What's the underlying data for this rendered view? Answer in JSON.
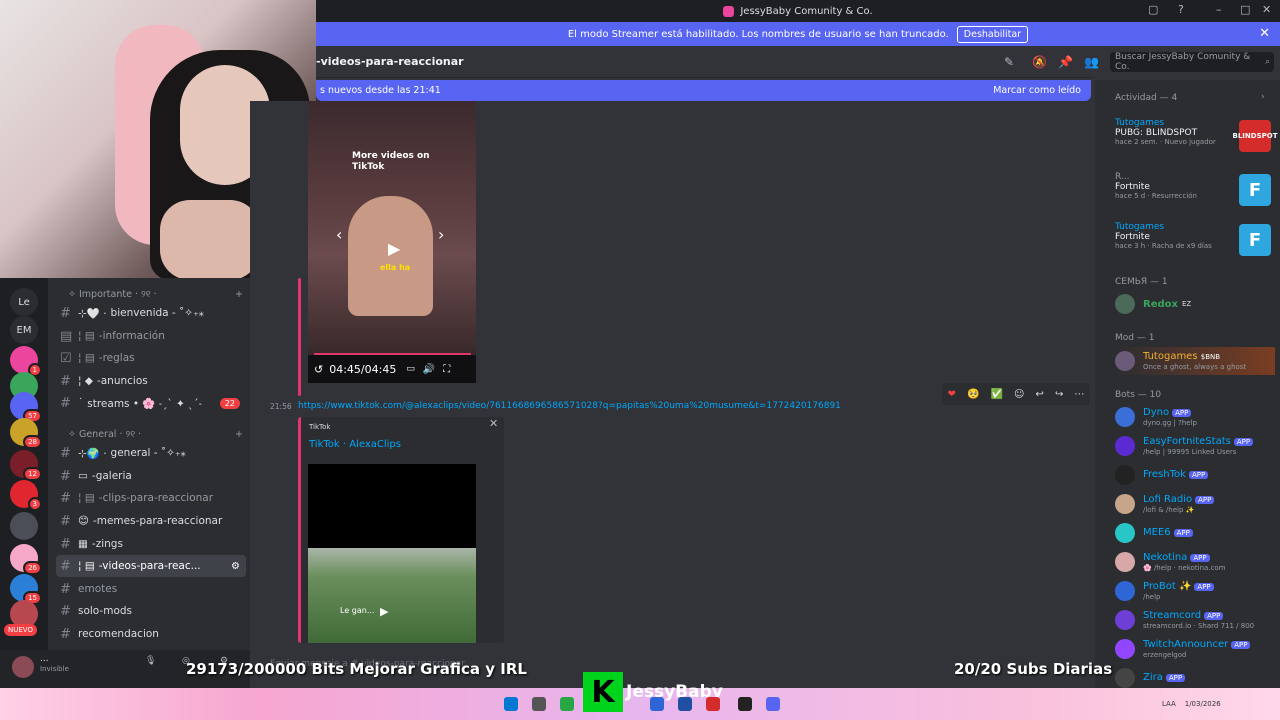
{
  "window": {
    "title": "JessyBaby Comunity & Co.",
    "controls": [
      "▢",
      "?",
      "–",
      "□",
      "✕"
    ]
  },
  "streamer_banner": {
    "text": "El modo Streamer está habilitado. Los nombres de usuario se han truncado.",
    "button": "Deshabilitar",
    "close": "✕"
  },
  "servers": [
    {
      "label": "Le"
    },
    {
      "label": "EM"
    },
    {
      "label": "",
      "badge": "1"
    },
    {
      "label": "",
      "badge": ""
    },
    {
      "label": "",
      "badge": "57"
    },
    {
      "label": "",
      "badge": "28"
    },
    {
      "label": "",
      "badge": "12"
    },
    {
      "label": "",
      "badge": "3"
    },
    {
      "label": "",
      "badge": ""
    },
    {
      "label": "",
      "badge": "26"
    },
    {
      "label": "",
      "badge": "15"
    },
    {
      "label": "",
      "badge": ""
    }
  ],
  "nuevo": "NUEVO",
  "categories": {
    "importante": "✧ Importante · ୨୧ ·",
    "general": "✧ General · ୨୧ ·"
  },
  "channels": [
    {
      "name": "bienvenida - ˚✧₊⁎",
      "prefix": "⊹🤍 ·"
    },
    {
      "name": "-información",
      "prefix": "¦ ▤"
    },
    {
      "name": "-reglas",
      "prefix": "¦ ▤"
    },
    {
      "name": "-anuncios",
      "prefix": "¦ ◆"
    },
    {
      "name": "streams • 🌸 ˗ˏˋ ✦ ˎˊ˗",
      "prefix": "˙",
      "badge": "22"
    },
    {
      "name": "general - ˚✧₊⁎",
      "prefix": "⊹🌍 ·"
    },
    {
      "name": "-galeria",
      "prefix": "▭"
    },
    {
      "name": "-clips-para-reaccionar",
      "prefix": "¦ ▤"
    },
    {
      "name": "-memes-para-reaccionar",
      "prefix": "😊"
    },
    {
      "name": "-zings",
      "prefix": "▦"
    },
    {
      "name": "-videos-para-reac...",
      "prefix": "¦ ▤"
    },
    {
      "name": "emotes",
      "prefix": ""
    },
    {
      "name": "solo-mods",
      "prefix": ""
    },
    {
      "name": "recomendacion",
      "prefix": ""
    }
  ],
  "user_panel": {
    "name": "...",
    "status": "Invisible"
  },
  "header": {
    "channel": "-videos-para-reaccionar",
    "search_placeholder": "Buscar JessyBaby Comunity & Co."
  },
  "new_messages": {
    "text": "s nuevos desde las 21:41",
    "mark_read": "Marcar como leído"
  },
  "video1": {
    "more": "More videos on TikTok",
    "caption": "ella ha",
    "time": "04:45/04:45"
  },
  "message": {
    "time": "21:56",
    "link": "https://www.tiktok.com/@alexaclips/video/7611668696586571028?q=papitas%20uma%20musume&t=1772420176891",
    "embed_provider": "TikTok",
    "embed_title": "TikTok · AlexaClips",
    "video_caption": "Le gan..."
  },
  "input_placeholder": "Enviar mensaje a #-videos-para-reaccionar",
  "members": {
    "activity_header": "Actividad — 4",
    "activities": [
      {
        "game": "Tutogames",
        "title": "PUBG: BLINDSPOT",
        "meta": "hace 2 sem. · Nuevo jugador",
        "tile": "BLINDSPOT",
        "tile_color": "#d42b2b"
      },
      {
        "game": "R...",
        "title": "Fortnite",
        "meta": "hace 5 d · Resurrección",
        "tile": "F",
        "tile_color": "#2ea7e0"
      },
      {
        "game": "Tutogames",
        "title": "Fortnite",
        "meta": "hace 3 h · Racha de x9 días",
        "tile": "F",
        "tile_color": "#2ea7e0"
      }
    ],
    "family_header": "СЕМЬЯ — 1",
    "family": [
      {
        "name": "Redox",
        "tag": "EZ",
        "color": "#3ba55c"
      }
    ],
    "mod_header": "Mod — 1",
    "mods": [
      {
        "name": "Tutogames",
        "tag": "$BNB",
        "sub": "Once a ghost, always a ghost",
        "color": "#f0b232"
      }
    ],
    "bots_header": "Bots — 10",
    "bots": [
      {
        "name": "Dyno",
        "sub": "dyno.gg | ?help",
        "color": "#00a8fc",
        "avatar": "#3a6fd8"
      },
      {
        "name": "EasyFortniteStats",
        "sub": "/help | 99995 Linked Users",
        "color": "#00a8fc",
        "avatar": "#5b2bd1"
      },
      {
        "name": "FreshTok",
        "sub": "",
        "color": "#00a8fc",
        "avatar": "#222"
      },
      {
        "name": "Lofi Radio",
        "sub": "/lofi & /help ✨",
        "color": "#00a8fc",
        "avatar": "#c7a58a"
      },
      {
        "name": "MEE6",
        "sub": "",
        "color": "#00a8fc",
        "avatar": "#29c6c8"
      },
      {
        "name": "Nekotina",
        "sub": "🌸 /help · nekotina.com",
        "color": "#00a8fc",
        "avatar": "#d7a8a8"
      },
      {
        "name": "ProBot ✨",
        "sub": "/help",
        "color": "#00a8fc",
        "avatar": "#2f66d6"
      },
      {
        "name": "Streamcord",
        "sub": "streamcord.io · Shard 711 / 800",
        "color": "#00a8fc",
        "avatar": "#6d3fd6"
      },
      {
        "name": "TwitchAnnouncer",
        "sub": "erzengelgod",
        "color": "#00a8fc",
        "avatar": "#9146ff"
      },
      {
        "name": "Zira",
        "sub": "",
        "color": "#00a8fc",
        "avatar": "#444"
      }
    ],
    "app_label": "APP"
  },
  "overlay": {
    "bits": "29173/200000 Bits Mejorar Grafica y IRL",
    "subs": "20/20 Subs Diarias",
    "brand": "JessyBaby",
    "logo": "K"
  },
  "tray": {
    "lang": "LAA",
    "date": "1/03/2026"
  }
}
